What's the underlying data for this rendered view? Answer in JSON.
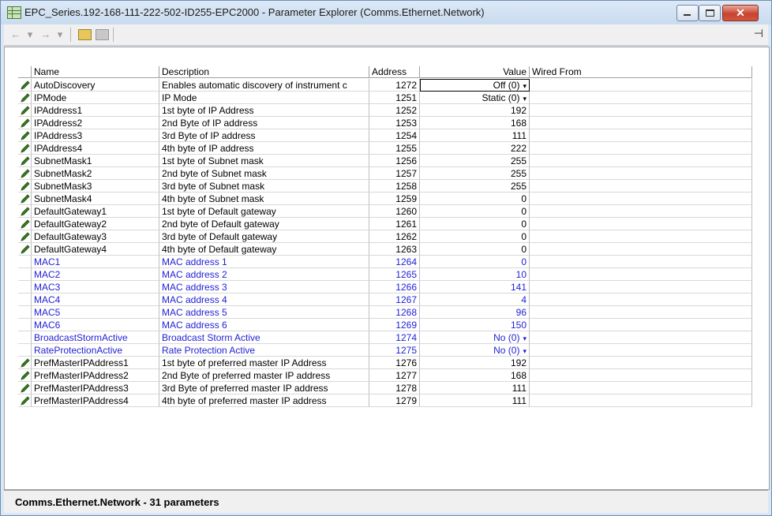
{
  "window": {
    "title": "EPC_Series.192-168-111-222-502-ID255-EPC2000 - Parameter Explorer (Comms.Ethernet.Network)"
  },
  "toolbar": {
    "back": "←",
    "fwd": "→",
    "dropdown": "▾",
    "pin": "⊣"
  },
  "columns": {
    "name": "Name",
    "description": "Description",
    "address": "Address",
    "value": "Value",
    "wired": "Wired From"
  },
  "rows": [
    {
      "name": "AutoDiscovery",
      "desc": "Enables automatic discovery of instrument c",
      "addr": "1272",
      "val": "Off (0)",
      "dd": true,
      "edit": true
    },
    {
      "name": "IPMode",
      "desc": "IP Mode",
      "addr": "1251",
      "val": "Static (0)",
      "dd": true,
      "edit": true
    },
    {
      "name": "IPAddress1",
      "desc": "1st byte of IP Address",
      "addr": "1252",
      "val": "192",
      "edit": true
    },
    {
      "name": "IPAddress2",
      "desc": "2nd Byte of IP address",
      "addr": "1253",
      "val": "168",
      "edit": true
    },
    {
      "name": "IPAddress3",
      "desc": "3rd Byte of IP address",
      "addr": "1254",
      "val": "111",
      "edit": true
    },
    {
      "name": "IPAddress4",
      "desc": "4th byte of IP address",
      "addr": "1255",
      "val": "222",
      "edit": true
    },
    {
      "name": "SubnetMask1",
      "desc": "1st byte of Subnet mask",
      "addr": "1256",
      "val": "255",
      "edit": true
    },
    {
      "name": "SubnetMask2",
      "desc": "2nd byte of Subnet mask",
      "addr": "1257",
      "val": "255",
      "edit": true
    },
    {
      "name": "SubnetMask3",
      "desc": "3rd byte of Subnet mask",
      "addr": "1258",
      "val": "255",
      "edit": true
    },
    {
      "name": "SubnetMask4",
      "desc": "4th byte of Subnet mask",
      "addr": "1259",
      "val": "0",
      "edit": true
    },
    {
      "name": "DefaultGateway1",
      "desc": "1st byte of Default gateway",
      "addr": "1260",
      "val": "0",
      "edit": true
    },
    {
      "name": "DefaultGateway2",
      "desc": "2nd byte of Default gateway",
      "addr": "1261",
      "val": "0",
      "edit": true
    },
    {
      "name": "DefaultGateway3",
      "desc": "3rd byte of Default gateway",
      "addr": "1262",
      "val": "0",
      "edit": true
    },
    {
      "name": "DefaultGateway4",
      "desc": "4th byte of Default gateway",
      "addr": "1263",
      "val": "0",
      "edit": true
    },
    {
      "name": "MAC1",
      "desc": "MAC address 1",
      "addr": "1264",
      "val": "0",
      "edit": false
    },
    {
      "name": "MAC2",
      "desc": "MAC address 2",
      "addr": "1265",
      "val": "10",
      "edit": false
    },
    {
      "name": "MAC3",
      "desc": "MAC address 3",
      "addr": "1266",
      "val": "141",
      "edit": false
    },
    {
      "name": "MAC4",
      "desc": "MAC address 4",
      "addr": "1267",
      "val": "4",
      "edit": false
    },
    {
      "name": "MAC5",
      "desc": "MAC address 5",
      "addr": "1268",
      "val": "96",
      "edit": false
    },
    {
      "name": "MAC6",
      "desc": "MAC address 6",
      "addr": "1269",
      "val": "150",
      "edit": false
    },
    {
      "name": "BroadcastStormActive",
      "desc": "Broadcast Storm Active",
      "addr": "1274",
      "val": "No (0)",
      "dd": true,
      "edit": false
    },
    {
      "name": "RateProtectionActive",
      "desc": "Rate Protection Active",
      "addr": "1275",
      "val": "No (0)",
      "dd": true,
      "edit": false
    },
    {
      "name": "PrefMasterIPAddress1",
      "desc": "1st byte of preferred master IP Address",
      "addr": "1276",
      "val": "192",
      "edit": true
    },
    {
      "name": "PrefMasterIPAddress2",
      "desc": "2nd Byte of preferred master IP address",
      "addr": "1277",
      "val": "168",
      "edit": true
    },
    {
      "name": "PrefMasterIPAddress3",
      "desc": "3rd Byte of preferred master IP address",
      "addr": "1278",
      "val": "111",
      "edit": true
    },
    {
      "name": "PrefMasterIPAddress4",
      "desc": "4th byte of preferred master IP address",
      "addr": "1279",
      "val": "111",
      "edit": true
    }
  ],
  "status": {
    "text": "Comms.Ethernet.Network  -  31 parameters"
  },
  "colors": {
    "readonly_text": "#1f1fd6",
    "pencil": "#3a7d1e"
  }
}
